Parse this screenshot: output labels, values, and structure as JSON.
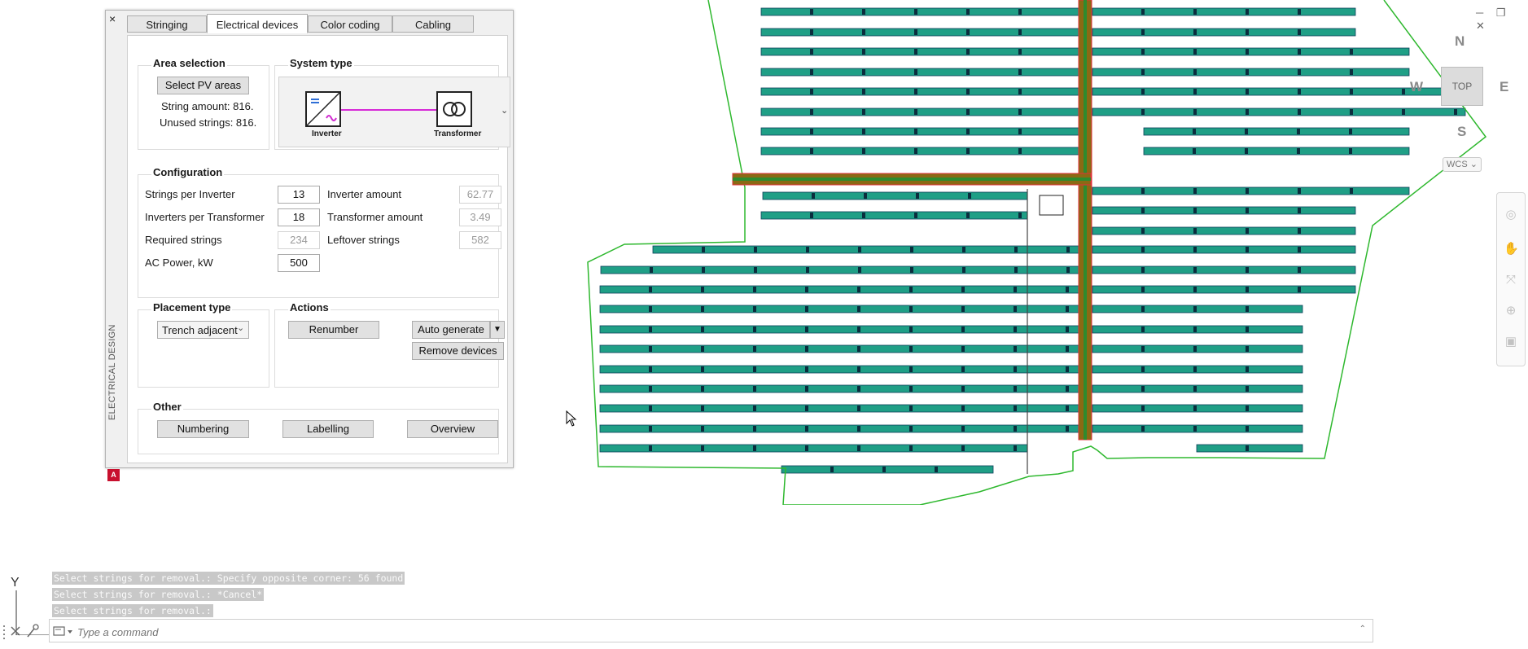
{
  "palette": {
    "close_label": "×",
    "vertical_title": "ELECTRICAL DESIGN",
    "logo_letter": "A",
    "tabs": [
      {
        "label": "Stringing",
        "active": false
      },
      {
        "label": "Electrical devices",
        "active": true
      },
      {
        "label": "Color coding",
        "active": false
      },
      {
        "label": "Cabling",
        "active": false
      }
    ],
    "area_selection": {
      "title": "Area selection",
      "select_button": "Select PV areas",
      "string_amount": "String amount: 816.",
      "unused_strings": "Unused strings: 816."
    },
    "system_type": {
      "title": "System type",
      "inverter_label": "Inverter",
      "transformer_label": "Transformer",
      "dropdown_glyph": "⌄"
    },
    "configuration": {
      "title": "Configuration",
      "strings_per_inverter": {
        "label": "Strings per Inverter",
        "value": "13"
      },
      "inverters_per_transformer": {
        "label": "Inverters per Transformer",
        "value": "18"
      },
      "required_strings": {
        "label": "Required strings",
        "value": "234"
      },
      "ac_power": {
        "label": "AC Power, kW",
        "value": "500"
      },
      "inverter_amount": {
        "label": "Inverter amount",
        "value": "62.77"
      },
      "transformer_amount": {
        "label": "Transformer amount",
        "value": "3.49"
      },
      "leftover_strings": {
        "label": "Leftover strings",
        "value": "582"
      }
    },
    "placement": {
      "title": "Placement type",
      "selected": "Trench adjacent",
      "chevron": "⌄"
    },
    "actions": {
      "title": "Actions",
      "renumber": "Renumber",
      "auto_generate": "Auto generate",
      "auto_generate_arrow": "▼",
      "remove_devices": "Remove devices"
    },
    "other": {
      "title": "Other",
      "numbering": "Numbering",
      "labelling": "Labelling",
      "overview": "Overview"
    }
  },
  "viewcube": {
    "north": "N",
    "south": "S",
    "east": "E",
    "west": "W",
    "face": "TOP",
    "coord_system": "WCS",
    "coord_chevron": "⌄"
  },
  "window_controls": "─ ❐ ✕",
  "ucs_label": "Y",
  "command": {
    "history": [
      "Select strings for removal.: Specify opposite corner: 56 found",
      "Select strings for removal.: *Cancel*",
      "Select strings for removal.:"
    ],
    "placeholder": "Type a command",
    "expand_glyph": "⌃"
  },
  "drawing": {
    "boundary_color": "#2eb82e",
    "module_fill": "#1f9f86",
    "module_stroke": "#0d3f5a",
    "trench_fill": "#8b6914",
    "trench_border": "#e0303a",
    "trench_core": "#2e8b2e"
  }
}
